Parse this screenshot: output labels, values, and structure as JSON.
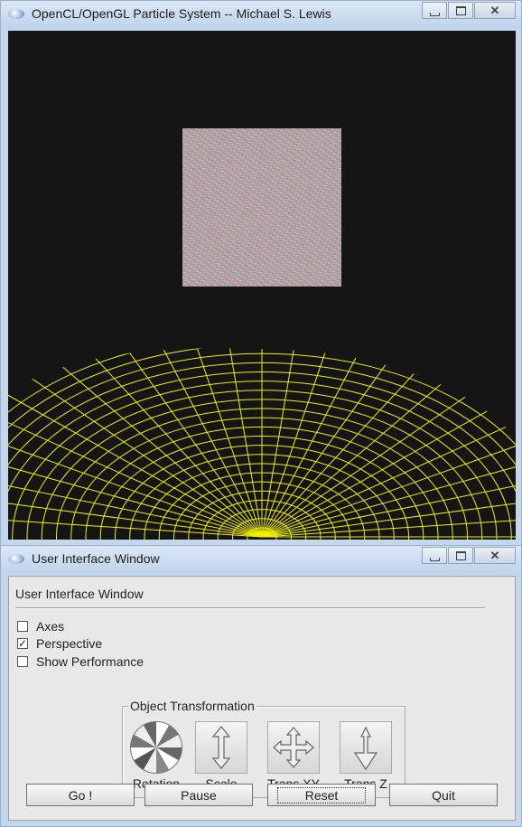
{
  "gl_window": {
    "title": "OpenCL/OpenGL Particle System -- Michael S. Lewis"
  },
  "ui_window": {
    "title": "User Interface Window",
    "panel_heading": "User Interface Window",
    "checkboxes": [
      {
        "label": "Axes",
        "checked": false
      },
      {
        "label": "Perspective",
        "checked": true
      },
      {
        "label": "Show Performance",
        "checked": false
      }
    ],
    "group": {
      "title": "Object Transformation",
      "tools": [
        {
          "label": "Rotation",
          "icon": "rotation-ball-icon"
        },
        {
          "label": "Scale",
          "icon": "vertical-arrows-icon"
        },
        {
          "label": "Trans XY",
          "icon": "four-way-arrows-icon"
        },
        {
          "label": "Trans Z",
          "icon": "depth-arrows-icon"
        }
      ]
    },
    "buttons": {
      "go": "Go !",
      "pause": "Pause",
      "reset": "Reset",
      "quit": "Quit"
    }
  },
  "colors": {
    "canvas_bg": "#151515",
    "sphere_wireframe": "#f0f000"
  }
}
